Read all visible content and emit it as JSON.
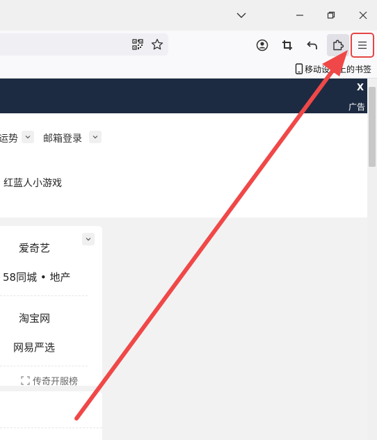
{
  "bookmarks": {
    "mobile_bookmarks_label": "移动设备上的书签"
  },
  "banner": {
    "close_label": "X",
    "ad_label": "广告"
  },
  "nav": {
    "fortune_label": "运势",
    "mail_login_label": "邮箱登录",
    "game_label": "红蓝人小游戏"
  },
  "links": {
    "iqiyi": "爱奇艺",
    "city58": "58同城 • 地产",
    "taobao": "淘宝网",
    "netease_yanxuan": "网易严选",
    "legend_servers": "传奇开服榜"
  },
  "colors": {
    "highlight_border": "#e64545",
    "arrow": "#f04848",
    "banner_bg": "#1c2b41"
  },
  "icons": [
    "chevron-down-icon",
    "minimize-icon",
    "restore-icon",
    "close-icon",
    "qr-code-icon",
    "star-icon",
    "account-icon",
    "crop-screenshot-icon",
    "undo-icon",
    "extensions-icon",
    "hamburger-menu-icon",
    "mobile-device-icon",
    "expand-icon"
  ]
}
